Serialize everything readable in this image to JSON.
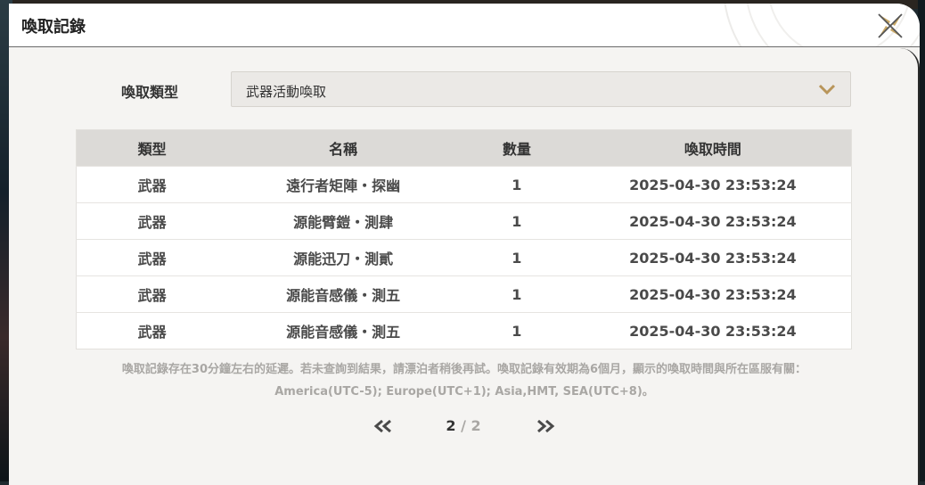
{
  "dialog": {
    "title": "喚取記錄"
  },
  "filter": {
    "label": "喚取類型",
    "selected": "武器活動喚取"
  },
  "table": {
    "headers": [
      "類型",
      "名稱",
      "數量",
      "喚取時間"
    ],
    "rows": [
      [
        "武器",
        "遠行者矩陣・探幽",
        "1",
        "2025-04-30 23:53:24"
      ],
      [
        "武器",
        "源能臂鎧・測肆",
        "1",
        "2025-04-30 23:53:24"
      ],
      [
        "武器",
        "源能迅刀・測貳",
        "1",
        "2025-04-30 23:53:24"
      ],
      [
        "武器",
        "源能音感儀・測五",
        "1",
        "2025-04-30 23:53:24"
      ],
      [
        "武器",
        "源能音感儀・測五",
        "1",
        "2025-04-30 23:53:24"
      ]
    ]
  },
  "note": {
    "line1": "喚取記錄存在30分鐘左右的延遲。若未查詢到結果，請漂泊者稍後再試。喚取記錄有效期為6個月，顯示的喚取時間與所在區服有關：",
    "line2": "America(UTC-5); Europe(UTC+1); Asia,HMT, SEA(UTC+8)。"
  },
  "pagination": {
    "current": "2",
    "separator": " / ",
    "total": "2"
  },
  "icons": {
    "close": "close-x-icon",
    "dropdown": "chevron-down-icon",
    "prev": "double-chevron-left-icon",
    "next": "double-chevron-right-icon"
  },
  "colors": {
    "accent": "#b8955a",
    "panel": "#f4f3f1",
    "header_row": "#dcdad7",
    "muted_text": "#a9a7a4"
  }
}
